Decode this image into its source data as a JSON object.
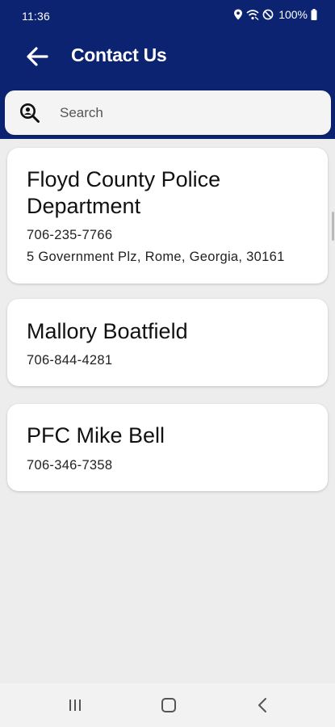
{
  "status_bar": {
    "time": "11:36",
    "battery": "100%"
  },
  "appbar": {
    "title": "Contact Us"
  },
  "search": {
    "placeholder": "Search",
    "value": ""
  },
  "contacts": [
    {
      "name": "Floyd County Police Department",
      "phone": "706-235-7766",
      "address": "5 Government Plz, Rome, Georgia, 30161"
    },
    {
      "name": "Mallory Boatfield",
      "phone": "706-844-4281"
    },
    {
      "name": "PFC Mike Bell",
      "phone": "706-346-7358"
    }
  ],
  "colors": {
    "header_bg": "#0b2370",
    "page_bg": "#ededed",
    "card_bg": "#ffffff"
  },
  "icons": {
    "back": "arrow-left-icon",
    "search": "search-person-icon",
    "nav_recents": "recents-icon",
    "nav_home": "home-icon",
    "nav_back": "chevron-left-icon"
  }
}
